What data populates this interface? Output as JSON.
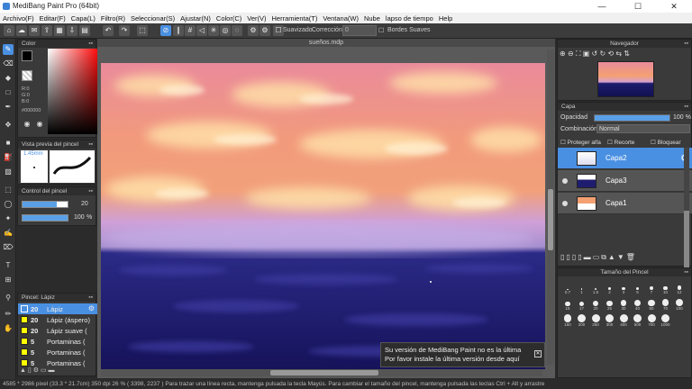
{
  "window": {
    "title": "MediBang Paint Pro (64bit)",
    "min": "—",
    "max": "☐",
    "close": "✕"
  },
  "menu": [
    "Archivo(F)",
    "Editar(F)",
    "Capa(L)",
    "Filtro(R)",
    "Seleccionar(S)",
    "Ajustar(N)",
    "Color(C)",
    "Ver(V)",
    "Herramienta(T)",
    "Ventana(W)",
    "Nube",
    "lapso de tiempo",
    "Help"
  ],
  "toolbar": {
    "smoothing_label": "Suavizado",
    "correction_label": "Corrección",
    "correction_value": "0",
    "soft_edges_label": "Bordes Suaves"
  },
  "document": {
    "tab": "sueños.mdp"
  },
  "color_panel": {
    "title": "Color",
    "r": "R:0",
    "g": "G:0",
    "b": "B:0",
    "hex": "#000000",
    "accent": "#4a90e2"
  },
  "brush_preview": {
    "title": "Vista previa del pincel",
    "size": "1.45mm"
  },
  "brush_control": {
    "title": "Control del pincel",
    "size_value": "20",
    "opacity_value": "100",
    "opacity_unit": "%",
    "size_fraction": 0.75,
    "opacity_fraction": 1.0
  },
  "brush_list": {
    "title": "Pincel: Lápiz",
    "items": [
      {
        "size": "20",
        "name": "Lápiz"
      },
      {
        "size": "20",
        "name": "Lápiz (áspero)"
      },
      {
        "size": "20",
        "name": "Lápiz suave ("
      },
      {
        "size": "5",
        "name": "Portaminas ("
      },
      {
        "size": "5",
        "name": "Portaminas ("
      },
      {
        "size": "5",
        "name": "Portaminas ("
      }
    ]
  },
  "navigator": {
    "title": "Navegador"
  },
  "layers": {
    "title": "Capa",
    "opacity_label": "Opacidad",
    "opacity_value": "100 %",
    "blend_label": "Combinación",
    "blend_value": "Normal",
    "protect_alpha": "Proteger alfa",
    "clip": "Recorte",
    "lock": "Bloquear",
    "items": [
      {
        "name": "Capa2"
      },
      {
        "name": "Capa3"
      },
      {
        "name": "Capa1"
      }
    ]
  },
  "brush_size": {
    "title": "Tamaño del Pincel",
    "labels": [
      "0.7",
      "1",
      "1.5",
      "2",
      "3",
      "5",
      "7",
      "10",
      "12",
      "15",
      "17",
      "20",
      "25",
      "30",
      "40",
      "50",
      "70",
      "100",
      "150",
      "200",
      "250",
      "300",
      "400",
      "500",
      "700",
      "1000"
    ]
  },
  "notice": {
    "line1": "Su versión de MediBang Paint no es la última",
    "line2": "Por favor instale la última versión desde aquí",
    "close": "✕"
  },
  "status": {
    "text": "4585 * 2986 pixel   (33.3 * 21.7cm)   350 dpi   26 %   ( 3398, 2237 )   Para trazar una línea recta, mantenga pulsada la tecla Mayús. Para cambiar el tamaño del pincel, mantenga pulsada las teclas Ctrl + Alt y arrastre"
  }
}
